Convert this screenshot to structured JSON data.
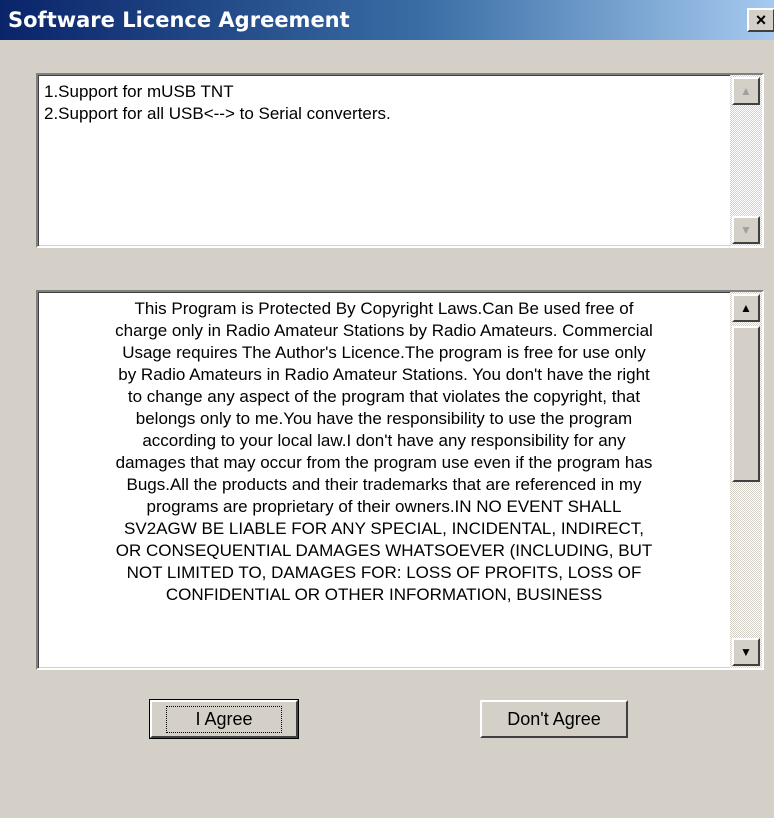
{
  "window": {
    "title": "Software Licence Agreement",
    "close_symbol": "×"
  },
  "changelog": {
    "lines": [
      "1.Support for mUSB TNT",
      "2.Support for all USB<--> to Serial converters."
    ]
  },
  "licence": {
    "lines": [
      "This Program is Protected By Copyright Laws.Can Be used  free of",
      "charge only in Radio Amateur Stations by Radio Amateurs. Commercial",
      "Usage requires The Author's Licence.The program  is free for use only",
      "by Radio Amateurs in Radio Amateur Stations. You don't have the right",
      "to change any aspect of the program that  violates the copyright, that",
      "belongs only to me.You have  the responsibility to use the program",
      "according to your local law.I don't have any responsibility for any",
      "damages that may occur from the program use even if the program has",
      "Bugs.All the products and their trademarks that are referenced in my",
      "programs are proprietary of their owners.IN NO EVENT SHALL",
      "SV2AGW BE LIABLE FOR ANY SPECIAL, INCIDENTAL, INDIRECT,",
      "OR CONSEQUENTIAL DAMAGES WHATSOEVER (INCLUDING, BUT",
      "NOT LIMITED TO, DAMAGES FOR:  LOSS OF PROFITS, LOSS OF",
      "CONFIDENTIAL OR OTHER INFORMATION, BUSINESS"
    ]
  },
  "buttons": {
    "agree": "I Agree",
    "disagree": "Don't Agree"
  },
  "icons": {
    "scroll_up": "▲",
    "scroll_down": "▼"
  }
}
